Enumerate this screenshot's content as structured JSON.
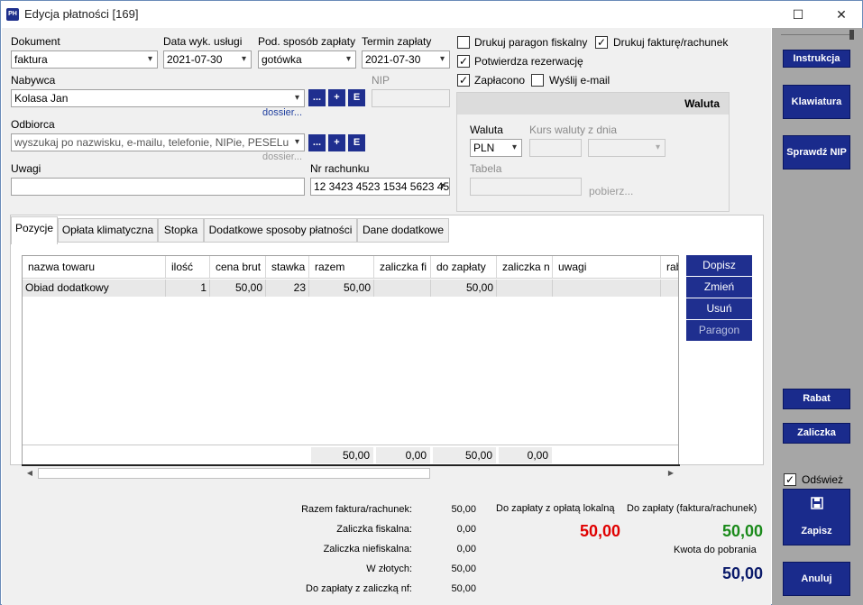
{
  "window": {
    "title": "Edycja płatności [169]",
    "app_icon_text": "PH",
    "maximize": "☐",
    "close": "✕"
  },
  "form": {
    "dokument": {
      "label": "Dokument",
      "value": "faktura"
    },
    "data_wyk": {
      "label": "Data wyk. usługi",
      "value": "2021-07-30"
    },
    "pod_sposob": {
      "label": "Pod. sposób zapłaty",
      "value": "gotówka"
    },
    "termin": {
      "label": "Termin zapłaty",
      "value": "2021-07-30"
    },
    "nabywca": {
      "label": "Nabywca",
      "value": "Kolasa Jan",
      "dossier": "dossier..."
    },
    "nip": {
      "label": "NIP",
      "value": ""
    },
    "odbiorca": {
      "label": "Odbiorca",
      "placeholder": "wyszukaj po nazwisku, e-mailu, telefonie, NIPie, PESELu",
      "dossier": "dossier..."
    },
    "uwagi": {
      "label": "Uwagi",
      "value": ""
    },
    "nr_rachunku": {
      "label": "Nr rachunku",
      "value": "12 3423 4523 1534 5623 45"
    },
    "small_buttons": {
      "more": "...",
      "add": "+",
      "edit": "E"
    }
  },
  "checks": {
    "paragon": {
      "label": "Drukuj paragon fiskalny",
      "checked": false
    },
    "faktura": {
      "label": "Drukuj fakturę/rachunek",
      "checked": true
    },
    "rezerwacja": {
      "label": "Potwierdza rezerwację",
      "checked": true
    },
    "zaplacono": {
      "label": "Zapłacono",
      "checked": true
    },
    "email": {
      "label": "Wyślij e-mail",
      "checked": false
    }
  },
  "waluta": {
    "header": "Waluta",
    "waluta_label": "Waluta",
    "waluta_value": "PLN",
    "kurs_label": "Kurs waluty",
    "zdnia_label": "z dnia",
    "tabela_label": "Tabela",
    "pobierz": "pobierz..."
  },
  "tabs": [
    "Pozycje",
    "Opłata klimatyczna",
    "Stopka",
    "Dodatkowe sposoby płatności",
    "Dane dodatkowe"
  ],
  "grid": {
    "columns": [
      "nazwa towaru",
      "ilość",
      "cena brut",
      "stawka",
      "razem",
      "zaliczka fi",
      "do zapłaty",
      "zaliczka n",
      "uwagi",
      "rab"
    ],
    "rows": [
      [
        "Obiad dodatkowy",
        "1",
        "50,00",
        "23",
        "50,00",
        "",
        "50,00",
        "",
        "",
        ""
      ]
    ],
    "footer": [
      "50,00",
      "0,00",
      "50,00",
      "0,00"
    ]
  },
  "grid_buttons": {
    "dopisz": "Dopisz",
    "zmien": "Zmień",
    "usun": "Usuń",
    "paragon": "Paragon"
  },
  "summary": {
    "razem": {
      "label": "Razem faktura/rachunek:",
      "value": "50,00"
    },
    "zal_fisk": {
      "label": "Zaliczka fiskalna:",
      "value": "0,00"
    },
    "zal_niefisk": {
      "label": "Zaliczka niefiskalna:",
      "value": "0,00"
    },
    "w_zlotych": {
      "label": "W złotych:",
      "value": "50,00"
    },
    "do_zaplaty_nf": {
      "label": "Do zapłaty z zaliczką nf:",
      "value": "50,00"
    },
    "oplata_lokalna": {
      "label": "Do zapłaty z opłatą lokalną",
      "value": "50,00",
      "color": "#e00000"
    },
    "do_zaplaty_fr": {
      "label": "Do zapłaty (faktura/rachunek)",
      "value": "50,00",
      "color": "#1a8a1a"
    },
    "kwota_pobrania": {
      "label": "Kwota do pobrania",
      "value": "50,00",
      "color": "#0a1a6a"
    }
  },
  "right": {
    "instrukcja": "Instrukcja",
    "klawiatura": "Klawiatura",
    "sprawdz_nip": "Sprawdź NIP",
    "rabat": "Rabat",
    "zaliczka": "Zaliczka",
    "odswiez": {
      "label": "Odśwież",
      "checked": true
    },
    "zapisz": "Zapisz",
    "anuluj": "Anuluj"
  }
}
